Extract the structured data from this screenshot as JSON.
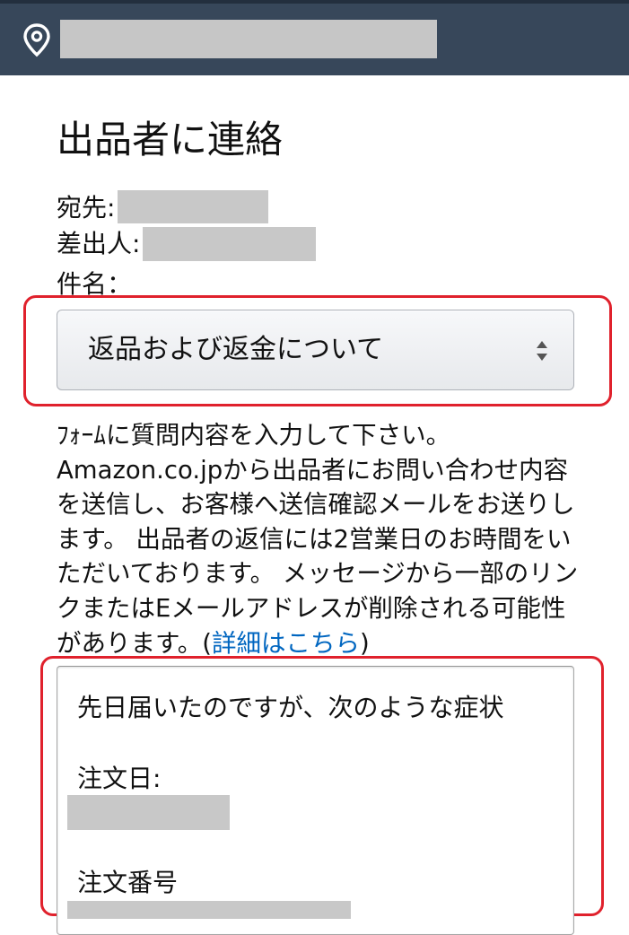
{
  "header": {
    "icon": "location-pin-icon",
    "colors": {
      "background": "#37475a"
    }
  },
  "page": {
    "title": "出品者に連絡",
    "to_label": "宛先:",
    "from_label": "差出人:",
    "subject_label": "件名："
  },
  "subject_select": {
    "selected": "返品および返金について",
    "icon": "sort-arrows-icon"
  },
  "description": {
    "text": "ﾌｫｰﾑに質問内容を入力して下さい。Amazon.co.jpから出品者にお問い合わせ内容を送信し、お客様へ送信確認メールをお送りします。 出品者の返信には2営業日のお時間をいただいております。 メッセージから一部のリンクまたはEメールアドレスが削除される可能性があります。(",
    "link": "詳細はこちら",
    "close": ")"
  },
  "message": {
    "line1": "先日届いたのですが、次のような症状",
    "order_date_label": "注文日:",
    "order_number_label": "注文番号"
  },
  "colors": {
    "highlight": "#e0212c",
    "link": "#0066c0"
  }
}
